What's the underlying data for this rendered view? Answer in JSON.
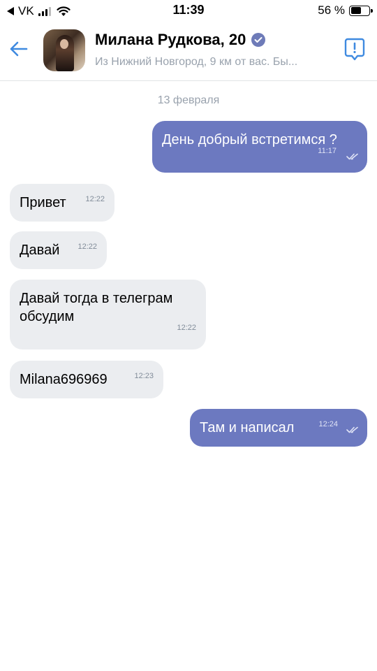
{
  "status_bar": {
    "carrier": "VK",
    "time": "11:39",
    "battery_percent": "56 %",
    "battery_level": 0.56
  },
  "header": {
    "name": "Милана Рудкова, 20",
    "subtitle": "Из Нижний Новгород, 9 км от вас. Бы...",
    "back_icon": "arrow-left-icon",
    "report_icon": "report-icon",
    "verified_icon": "verified-icon"
  },
  "chat": {
    "date": "13 февраля",
    "messages": [
      {
        "direction": "out",
        "text": "День добрый встретимся ?",
        "time": "11:17",
        "read": true
      },
      {
        "direction": "in",
        "text": "Привет",
        "time": "12:22"
      },
      {
        "direction": "in",
        "text": "Давай",
        "time": "12:22"
      },
      {
        "direction": "in",
        "text_line1": "Давай тогда в телеграм",
        "text_line2": "обсудим",
        "time": "12:22"
      },
      {
        "direction": "in",
        "text": "Milana696969",
        "time": "12:23"
      },
      {
        "direction": "out",
        "text": "Там и написал",
        "time": "12:24",
        "read": true
      }
    ]
  },
  "colors": {
    "outgoing_bubble": "#6c79c0",
    "incoming_bubble": "#ebedf0",
    "accent": "#3f8ae0",
    "muted_text": "#99a2ad"
  }
}
